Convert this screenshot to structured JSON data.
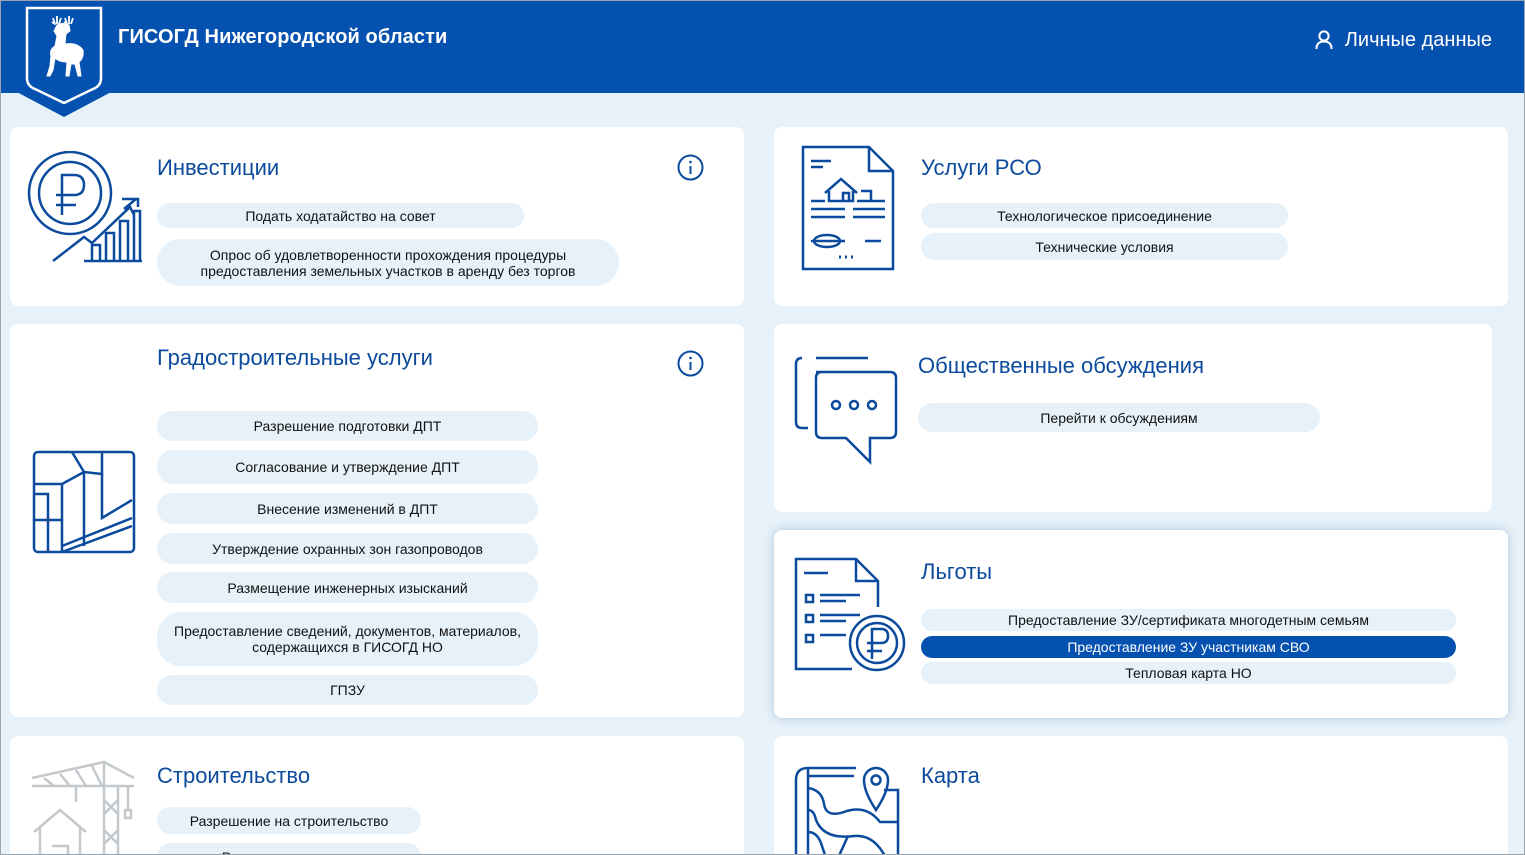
{
  "header": {
    "title": "ГИСОГД Нижегородской области",
    "personal_label": "Личные данные"
  },
  "colors": {
    "brand": "#0551b0",
    "background": "#e6f1f9",
    "pill": "#e6f1f9",
    "pill_active": "#0551b0",
    "icon_stroke": "#0b4a9c"
  },
  "cards": {
    "investments": {
      "title": "Инвестиции",
      "items": [
        "Подать ходатайство на совет",
        "Опрос об удовлетворенности прохождения процедуры предоставления земельных участков в аренду без торгов"
      ]
    },
    "rso": {
      "title": "Услуги РСО",
      "items": [
        "Технологическое присоединение",
        "Технические условия"
      ]
    },
    "urban": {
      "title": "Градостроительные услуги",
      "items": [
        "Разрешение подготовки ДПТ",
        "Согласование и утверждение ДПТ",
        "Внесение изменений в ДПТ",
        "Утверждение охранных зон газопроводов",
        "Размещение инженерных изысканий",
        "Предоставление сведений, документов, материалов, содержащихся в ГИСОГД НО",
        "ГПЗУ"
      ]
    },
    "discussions": {
      "title": "Общественные обсуждения",
      "items": [
        "Перейти к обсуждениям"
      ]
    },
    "benefits": {
      "title": "Льготы",
      "items": [
        "Предоставление ЗУ/сертификата многодетным семьям",
        "Предоставление ЗУ участникам СВО",
        "Тепловая карта НО"
      ]
    },
    "construction": {
      "title": "Строительство",
      "items": [
        "Разрешение на строительство",
        "Разрешение на ввод"
      ]
    },
    "map": {
      "title": "Карта"
    }
  }
}
